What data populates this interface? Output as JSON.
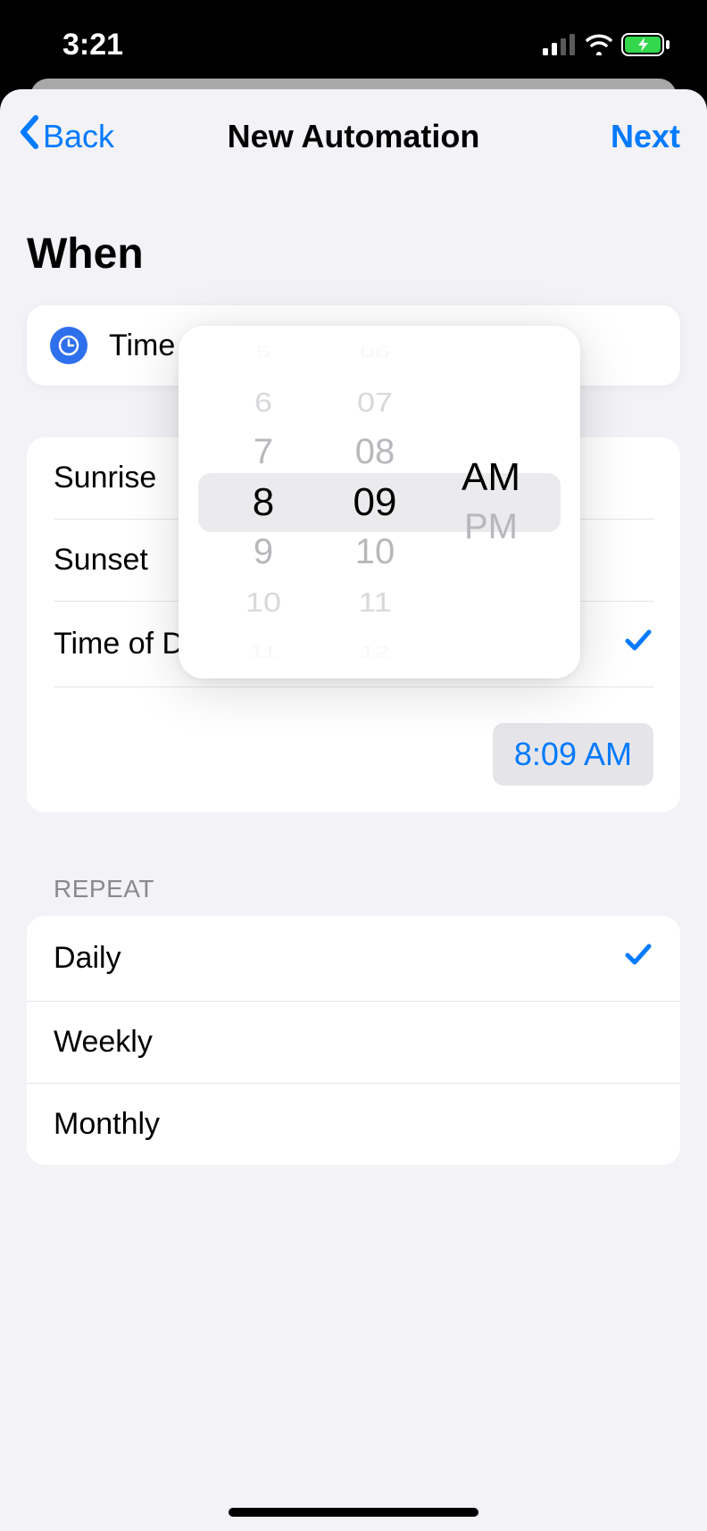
{
  "status_bar": {
    "time": "3:21"
  },
  "nav": {
    "back_label": "Back",
    "title": "New Automation",
    "next_label": "Next"
  },
  "when": {
    "title": "When",
    "header_label": "Time of Day",
    "options": {
      "sunrise": "Sunrise",
      "sunset": "Sunset",
      "time_of_day": "Time of Day"
    },
    "selected": "time_of_day",
    "time_pill": "8:09 AM"
  },
  "picker": {
    "hours": [
      "5",
      "6",
      "7",
      "8",
      "9",
      "10",
      "11"
    ],
    "minutes": [
      "06",
      "07",
      "08",
      "09",
      "10",
      "11",
      "12"
    ],
    "ampm": [
      "AM",
      "PM"
    ],
    "selected_hour": "8",
    "selected_minute": "09",
    "selected_ampm": "AM"
  },
  "repeat": {
    "label": "REPEAT",
    "options": {
      "daily": "Daily",
      "weekly": "Weekly",
      "monthly": "Monthly"
    },
    "selected": "daily"
  }
}
